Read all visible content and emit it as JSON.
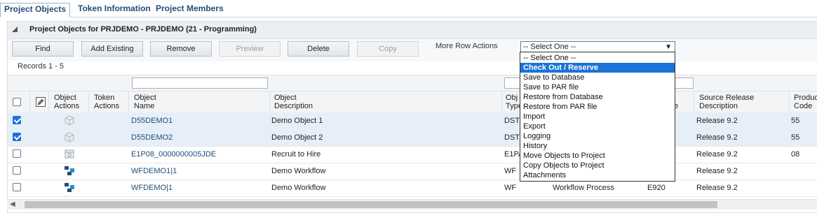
{
  "tabs": {
    "t0": "Project Objects",
    "t1": "Token Information",
    "t2": "Project Members"
  },
  "panel": {
    "title": "Project Objects for PRJDEMO - PRJDEMO  (21 - Programming)"
  },
  "buttons": {
    "find": "Find",
    "add_existing": "Add Existing",
    "remove": "Remove",
    "preview": "Preview",
    "delete": "Delete",
    "copy": "Copy"
  },
  "more_row_actions": {
    "label": "More Row Actions",
    "selected": "-- Select One --"
  },
  "records": "Records 1 - 5",
  "columns": {
    "object_actions": [
      "Object",
      "Actions"
    ],
    "token_actions": [
      "Token",
      "Actions"
    ],
    "object_name": [
      "Object",
      "Name"
    ],
    "object_description": [
      "Object",
      "Description"
    ],
    "object_type": [
      "Obj",
      "Type"
    ],
    "source_release_code": [
      "",
      "e"
    ],
    "source_release_description": [
      "Source Release",
      "Description"
    ],
    "product_code": [
      "Produc",
      "Code"
    ]
  },
  "rows": [
    {
      "selected": true,
      "name": "D55DEMO1",
      "desc": "Demo Object 1",
      "type": "DSTR",
      "type_desc": "",
      "release": "",
      "release_desc": "Release 9.2",
      "product": "55"
    },
    {
      "selected": true,
      "name": "D55DEMO2",
      "desc": "Demo Object 2",
      "type": "DSTR",
      "type_desc": "",
      "release": "",
      "release_desc": "Release 9.2",
      "product": "55"
    },
    {
      "selected": false,
      "name": "E1P08_0000000005JDE",
      "desc": "Recruit to Hire",
      "type": "E1PA",
      "type_desc": "",
      "release": "",
      "release_desc": "Release 9.2",
      "product": "08"
    },
    {
      "selected": false,
      "name": "WFDEMO1|1",
      "desc": "Demo Workflow",
      "type": "WF",
      "type_desc": "",
      "release": "",
      "release_desc": "Release 9.2",
      "product": ""
    },
    {
      "selected": false,
      "name": "WFDEMO|1",
      "desc": "Demo Workflow",
      "type": "WF",
      "type_desc": "Workflow Process",
      "release": "E920",
      "release_desc": "Release 9.2",
      "product": ""
    }
  ],
  "dropdown": {
    "options": [
      "-- Select One --",
      "Check Out / Reserve",
      "Save to Database",
      "Save to PAR file",
      "Restore from Database",
      "Restore from PAR file",
      "Import",
      "Export",
      "Logging",
      "History",
      "Move Objects to Project",
      "Copy Objects to Project",
      "Attachments"
    ]
  },
  "colors": {
    "accent": "#1a73d9",
    "link": "#1f4e79",
    "selected_row": "#e6eff8"
  }
}
